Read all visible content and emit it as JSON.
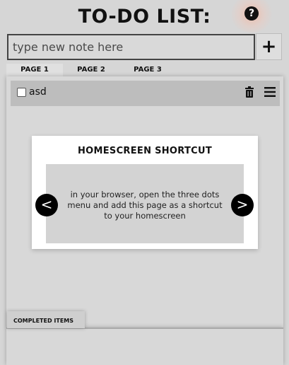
{
  "app": {
    "title": "TO-DO LIST:",
    "help_icon": "question-circle-icon"
  },
  "input": {
    "placeholder": "type new note here",
    "value": "",
    "add_label": "+"
  },
  "tabs": [
    {
      "label": "PAGE 1",
      "active": true
    },
    {
      "label": "PAGE 2",
      "active": false
    },
    {
      "label": "PAGE 3",
      "active": false
    }
  ],
  "notes": [
    {
      "text": "asd",
      "checked": false
    }
  ],
  "popup": {
    "title": "HOMESCREEN SHORTCUT",
    "body": "in your browser, open the three dots menu and add this page as a shortcut to your homescreen",
    "prev_label": "<",
    "next_label": ">"
  },
  "completed": {
    "label": "COMPLETED ITEMS"
  },
  "colors": {
    "background": "#d6d6d6",
    "note_row": "#bdbdbd",
    "popup_bg": "#ffffff",
    "popup_inner": "#d3d3d3",
    "help_glow": "#ffaa8c"
  }
}
